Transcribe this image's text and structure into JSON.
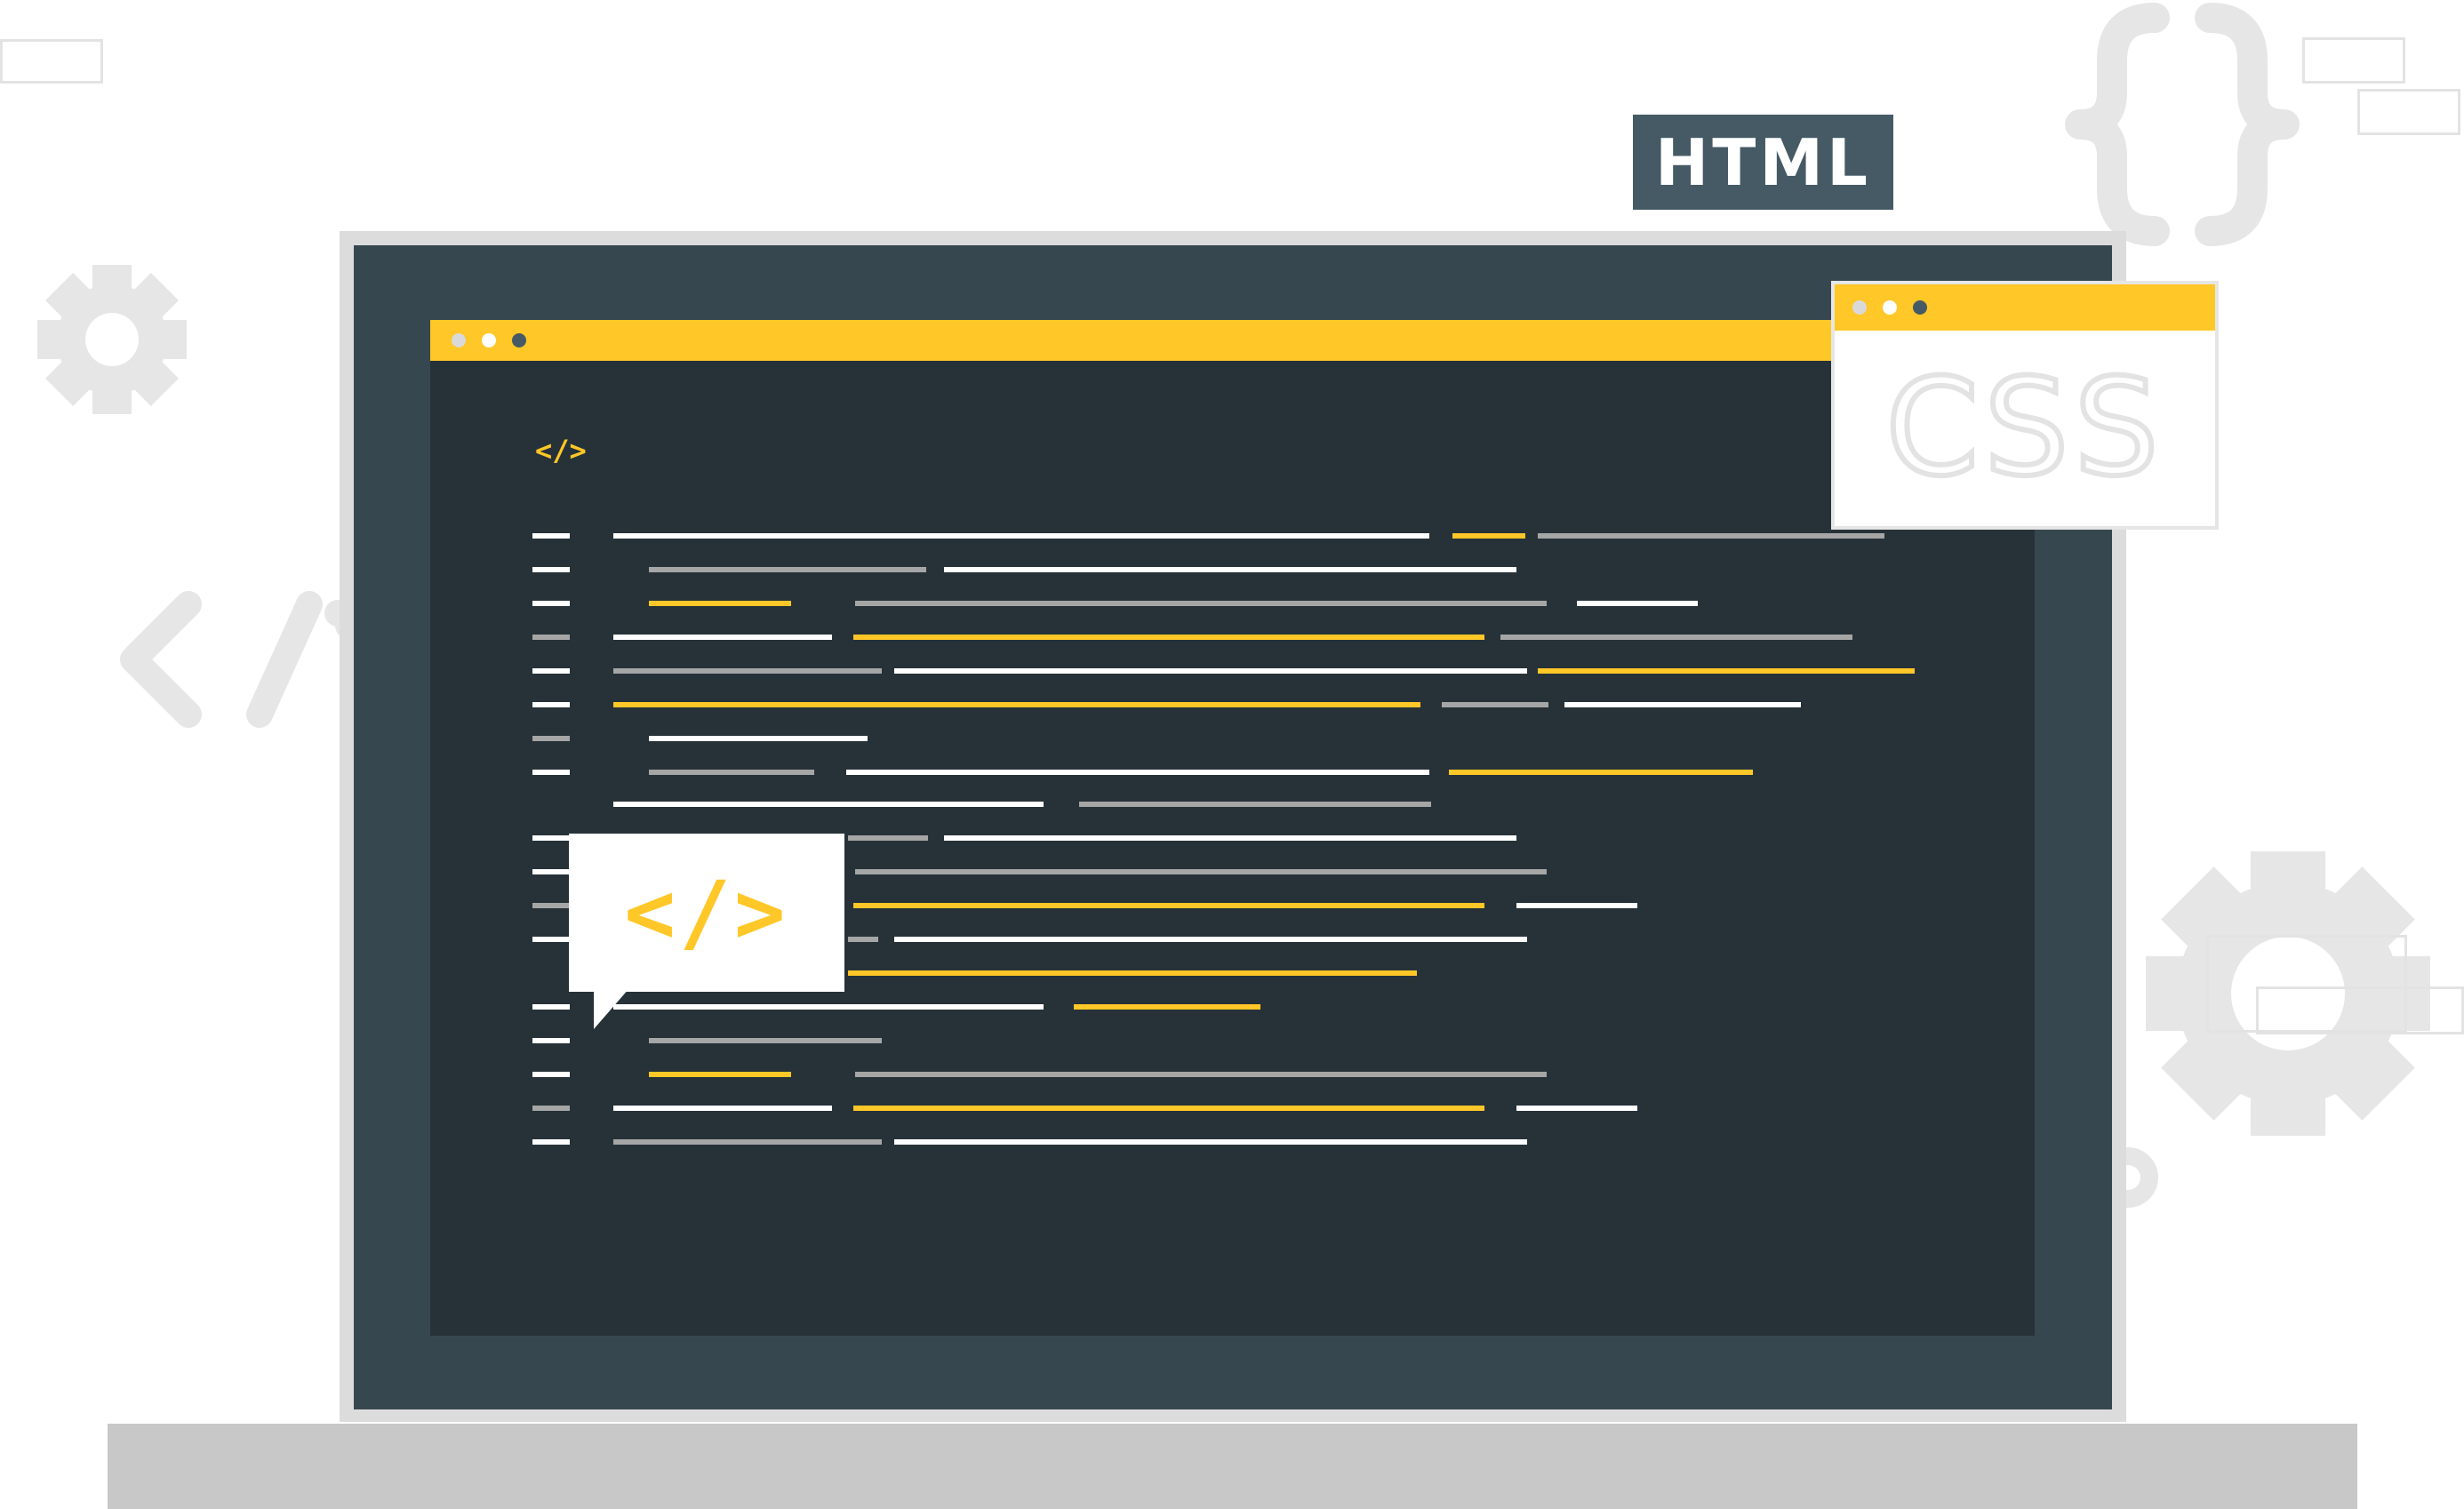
{
  "illustration": {
    "html_badge": "HTML",
    "css_badge": "CSS",
    "editor_tag": "</>",
    "callout_tag": "</>",
    "background_tag": "</",
    "braces": "{}",
    "colors": {
      "accent": "#ffc727",
      "screen": "#37474f",
      "editor_bg": "#263238",
      "badge_bg": "#455a64",
      "code_white": "#ffffff",
      "code_gray": "#a6a6a6",
      "code_yellow": "#ffc727",
      "decoration": "#e6e6e6"
    },
    "icons": [
      "gear-icon",
      "curly-braces-icon",
      "code-tag-icon",
      "window-dots-icon"
    ]
  }
}
